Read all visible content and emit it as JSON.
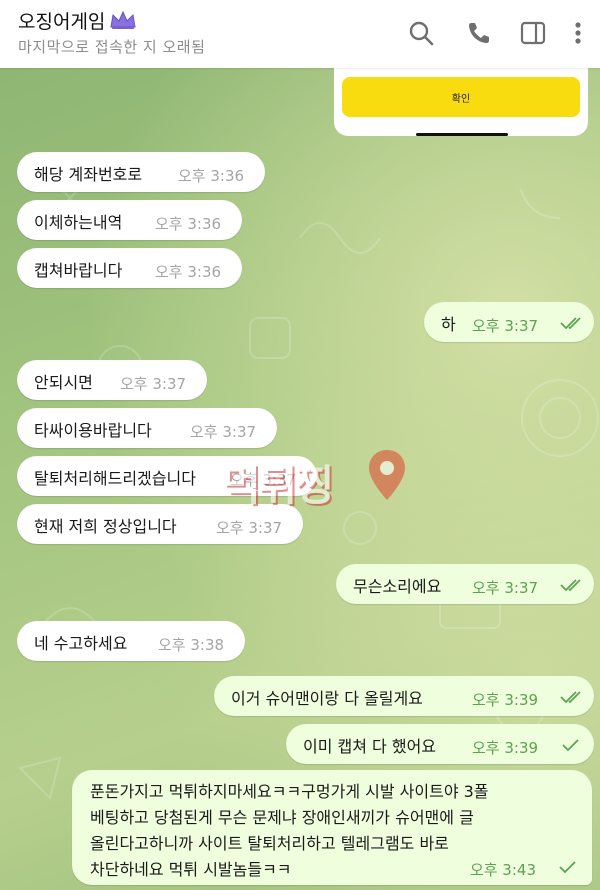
{
  "header": {
    "title": "오징어게임",
    "status": "마지막으로 접속한 지 오래됨",
    "icons": [
      "search-icon",
      "phone-icon",
      "sidebar-icon",
      "more-icon"
    ]
  },
  "card": {
    "button_label": "확인"
  },
  "watermark": {
    "text": "먹튀찡"
  },
  "messages": [
    {
      "text": "해당 계좌번호로",
      "time": "오후 3:36"
    },
    {
      "text": "이체하는내역",
      "time": "오후 3:36"
    },
    {
      "text": "캡쳐바랍니다",
      "time": "오후 3:36"
    },
    {
      "text": "하",
      "time": "오후 3:37"
    },
    {
      "text": "안되시면",
      "time": "오후 3:37"
    },
    {
      "text": "타싸이용바랍니다",
      "time": "오후 3:37"
    },
    {
      "text": "탈퇴처리해드리겠습니다",
      "time": "오후 3:37"
    },
    {
      "text": "현재 저희 정상입니다",
      "time": "오후 3:37"
    },
    {
      "text": "무슨소리에요",
      "time": "오후 3:37"
    },
    {
      "text": "네 수고하세요",
      "time": "오후 3:38"
    },
    {
      "text": "이거 슈어맨이랑 다 올릴게요",
      "time": "오후 3:39"
    },
    {
      "text": "이미 캡쳐 다 했어요",
      "time": "오후 3:39"
    },
    {
      "lines": [
        "푼돈가지고 먹튀하지마세요ㅋㅋ구멍가게 시발 사이트야 3폴",
        "베팅하고 당첨된게 무슨 문제냐 장애인새끼가 슈어맨에 글",
        "올린다고하니까 사이트 탈퇴처리하고 텔레그램도 바로",
        "차단하네요 먹튀 시발놈들ㅋㅋ"
      ],
      "time": "오후 3:43"
    }
  ],
  "colors": {
    "incoming_bubble": "#ffffff",
    "outgoing_bubble": "#effedd",
    "outgoing_time": "#5ea152",
    "confirm_button": "#f9dc10"
  }
}
